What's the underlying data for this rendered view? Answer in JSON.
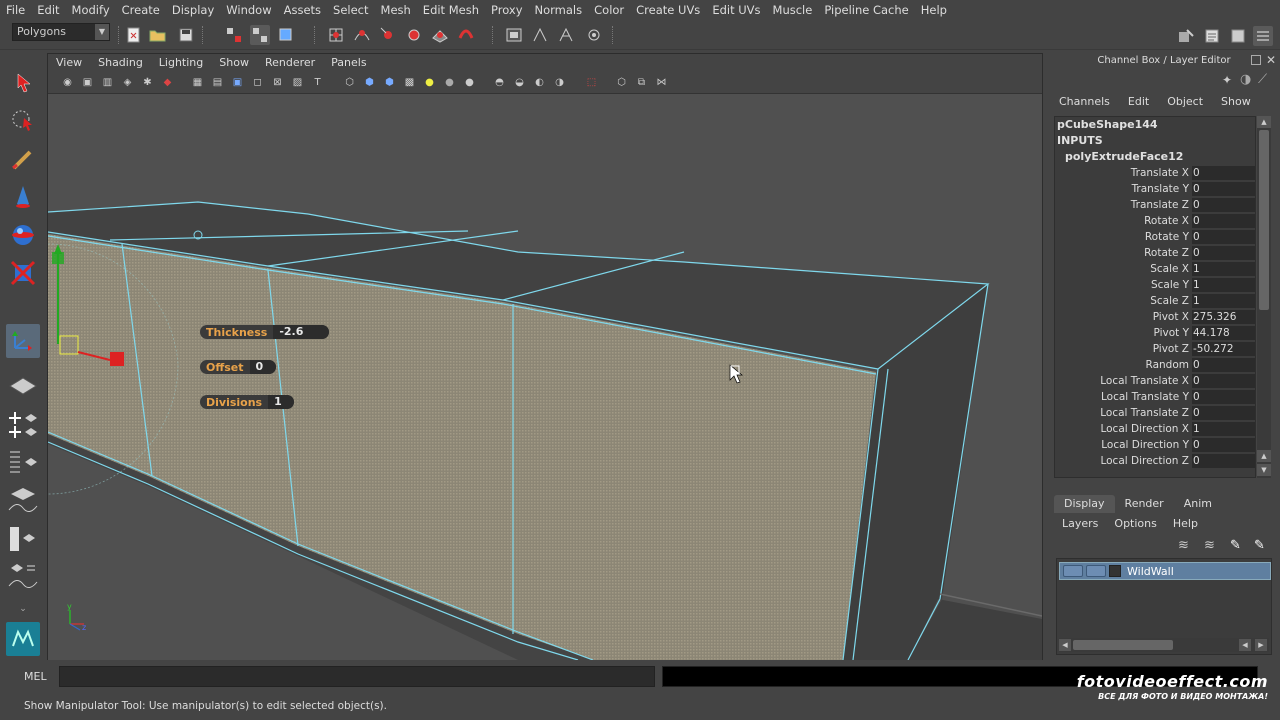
{
  "menubar": [
    "File",
    "Edit",
    "Modify",
    "Create",
    "Display",
    "Window",
    "Assets",
    "Select",
    "Mesh",
    "Edit Mesh",
    "Proxy",
    "Normals",
    "Color",
    "Create UVs",
    "Edit UVs",
    "Muscle",
    "Pipeline Cache",
    "Help"
  ],
  "mode_selector": {
    "value": "Polygons"
  },
  "viewport": {
    "menu": [
      "View",
      "Shading",
      "Lighting",
      "Show",
      "Renderer",
      "Panels"
    ],
    "hud": [
      {
        "label": "Thickness",
        "value": "-2.6"
      },
      {
        "label": "Offset",
        "value": "0"
      },
      {
        "label": "Divisions",
        "value": "1"
      }
    ],
    "axis": {
      "x": "x",
      "y": "y",
      "z": "z"
    }
  },
  "channel_box": {
    "title": "Channel Box / Layer Editor",
    "menu": [
      "Channels",
      "Edit",
      "Object",
      "Show"
    ],
    "shape": "pCubeShape144",
    "inputs": "INPUTS",
    "node": "polyExtrudeFace12",
    "attributes": [
      {
        "name": "Translate X",
        "value": "0"
      },
      {
        "name": "Translate Y",
        "value": "0"
      },
      {
        "name": "Translate Z",
        "value": "0"
      },
      {
        "name": "Rotate X",
        "value": "0"
      },
      {
        "name": "Rotate Y",
        "value": "0"
      },
      {
        "name": "Rotate Z",
        "value": "0"
      },
      {
        "name": "Scale X",
        "value": "1"
      },
      {
        "name": "Scale Y",
        "value": "1"
      },
      {
        "name": "Scale Z",
        "value": "1"
      },
      {
        "name": "Pivot X",
        "value": "275.326"
      },
      {
        "name": "Pivot Y",
        "value": "44.178"
      },
      {
        "name": "Pivot Z",
        "value": "-50.272"
      },
      {
        "name": "Random",
        "value": "0"
      },
      {
        "name": "Local Translate X",
        "value": "0"
      },
      {
        "name": "Local Translate Y",
        "value": "0"
      },
      {
        "name": "Local Translate Z",
        "value": "0"
      },
      {
        "name": "Local Direction X",
        "value": "1"
      },
      {
        "name": "Local Direction Y",
        "value": "0"
      },
      {
        "name": "Local Direction Z",
        "value": "0"
      }
    ]
  },
  "layer_editor": {
    "tabs": [
      "Display",
      "Render",
      "Anim"
    ],
    "active_tab": "Display",
    "menu": [
      "Layers",
      "Options",
      "Help"
    ],
    "layers": [
      {
        "name": "WildWall"
      }
    ]
  },
  "command_line": {
    "label": "MEL"
  },
  "help_line": "Show Manipulator Tool: Use manipulator(s) to edit selected object(s).",
  "watermark": {
    "site": "fotovideoeffect.com",
    "tagline": "ВСЕ ДЛЯ ФОТО И ВИДЕО МОНТАЖА!"
  },
  "colors": {
    "wire": "#7fd8ec",
    "hud_label": "#e8a24a",
    "selected_face": "#8c8675"
  }
}
